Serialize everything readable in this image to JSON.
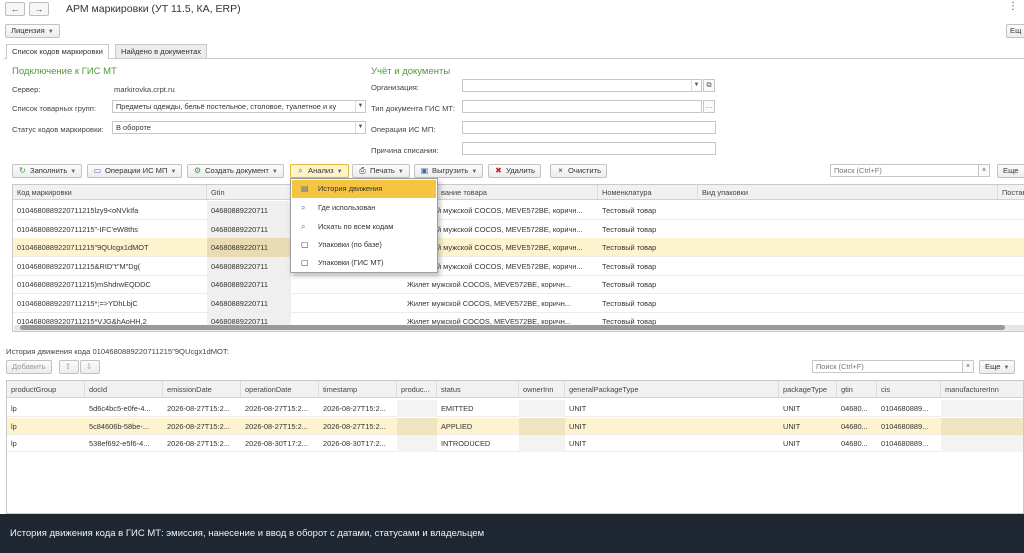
{
  "window": {
    "title": "АРМ маркировки (УТ 11.5, КА, ERP)",
    "more": "Ещ",
    "back_icon": "arrow-left-icon",
    "forward_icon": "arrow-right-icon"
  },
  "license_button": "Лицензия",
  "tabs": [
    "Список кодов маркировки",
    "Найдено в документах"
  ],
  "gis": {
    "section_title": "Подключение к ГИС МТ",
    "server_label": "Сервер:",
    "server_value": "markirovka.crpt.ru",
    "groups_label": "Список товарных групп:",
    "groups_value": "Предметы одежды, бельё постельное, столовое, туалетное и ку",
    "status_label": "Статус кодов маркировки:",
    "status_value": "В обороте"
  },
  "docs": {
    "section_title": "Учёт и документы",
    "org_label": "Организация:",
    "org_value": "",
    "doctype_label": "Тип документа ГИС МТ:",
    "doctype_value": "",
    "op_label": "Операция ИС МП:",
    "op_value": "",
    "reason_label": "Причина списания:",
    "reason_value": ""
  },
  "toolbar": {
    "fill": "Заполнить",
    "ops": "Операции ИС МП",
    "create": "Создать документ",
    "analysis": "Анализ",
    "print": "Печать",
    "export": "Выгрузить",
    "delete": "Удалить",
    "clear": "Очистить",
    "search_placeholder": "Поиск (Ctrl+F)",
    "more": "Еще"
  },
  "main_table": {
    "columns": [
      "Код маркировки",
      "Gtin",
      "Наименование товара",
      "Номенклатура",
      "Вид упаковки",
      "Постав"
    ],
    "header_partial": "вание товара",
    "rows": [
      {
        "code": "0104680889220711215lzy9<oNVkIfa",
        "gtin": "04680889220711",
        "name": "Жилет мужской COCOS, MEVE572BE, коричн...",
        "nom": "Тестовый товар"
      },
      {
        "code": "0104680889220711215\"-IFC'eW8ths",
        "gtin": "04680889220711",
        "name": "Жилет мужской COCOS, MEVE572BE, коричн...",
        "nom": "Тестовый товар"
      },
      {
        "code": "0104680889220711215\"9QUcgx1dMOT",
        "gtin": "04680889220711",
        "name": "Жилет мужской COCOS, MEVE572BE, коричн...",
        "nom": "Тестовый товар"
      },
      {
        "code": "0104680889220711215&RID\"t\"M\"Dg(",
        "gtin": "04680889220711",
        "name": "Жилет мужской COCOS, MEVE572BE, коричн...",
        "nom": "Тестовый товар"
      },
      {
        "code": "0104680889220711215)mShdrwEQDDC",
        "gtin": "04680889220711",
        "name": "Жилет мужской COCOS, MEVE572BE, коричн...",
        "nom": "Тестовый товар"
      },
      {
        "code": "0104680889220711215*;=>YDhLbjC",
        "gtin": "04680889220711",
        "name": "Жилет мужской COCOS, MEVE572BE, коричн...",
        "nom": "Тестовый товар"
      },
      {
        "code": "0104680889220711215*VJG&hAoHH,2",
        "gtin": "04680889220711",
        "name": "Жилет мужской COCOS, MEVE572BE, коричн...",
        "nom": "Тестовый товар"
      }
    ],
    "name_partial": "й мужской COCOS, MEVE572BE, коричн..."
  },
  "analysis_menu": [
    "История движения",
    "Где использован",
    "Искать по всем кодам",
    "Упаковки (по базе)",
    "Упаковки (ГИС МТ)"
  ],
  "history": {
    "title": "История движения кода 0104680889220711215\"9QUcgx1dMOT:",
    "add": "Добавить",
    "search_placeholder": "Поиск (Ctrl+F)",
    "more": "Еще",
    "columns": [
      "productGroup",
      "docId",
      "emissionDate",
      "operationDate",
      "timestamp",
      "produc...",
      "status",
      "ownerInn",
      "generalPackageType",
      "packageType",
      "gtin",
      "cis",
      "manufacturerInn"
    ],
    "rows": [
      [
        "lp",
        "5d6c4bc5-e0fe-4...",
        "2026-08-27T15:2...",
        "2026-08-27T15:2...",
        "2026-08-27T15:2...",
        "",
        "EMITTED",
        "",
        "UNIT",
        "UNIT",
        "04680...",
        "0104680889...",
        ""
      ],
      [
        "lp",
        "5c84606b-58be-...",
        "2026-08-27T15:2...",
        "2026-08-27T15:2...",
        "2026-08-27T15:2...",
        "",
        "APPLIED",
        "",
        "UNIT",
        "UNIT",
        "04680...",
        "0104680889...",
        ""
      ],
      [
        "lp",
        "538ef692-e5f6-4...",
        "2026-08-27T15:2...",
        "2026-08-30T17:2...",
        "2026-08-30T17:2...",
        "",
        "INTRODUCED",
        "",
        "UNIT",
        "UNIT",
        "04680...",
        "0104680889...",
        ""
      ]
    ]
  },
  "caption": "История движения кода в ГИС МТ: эмиссия, нанесение и ввод в оборот с датами, статусами и владельцем",
  "colors": {
    "section": "#4d9a3a",
    "selected_row": "#fdf3cf",
    "menu_highlight": "#f5c542",
    "banner": "#1f2732"
  }
}
